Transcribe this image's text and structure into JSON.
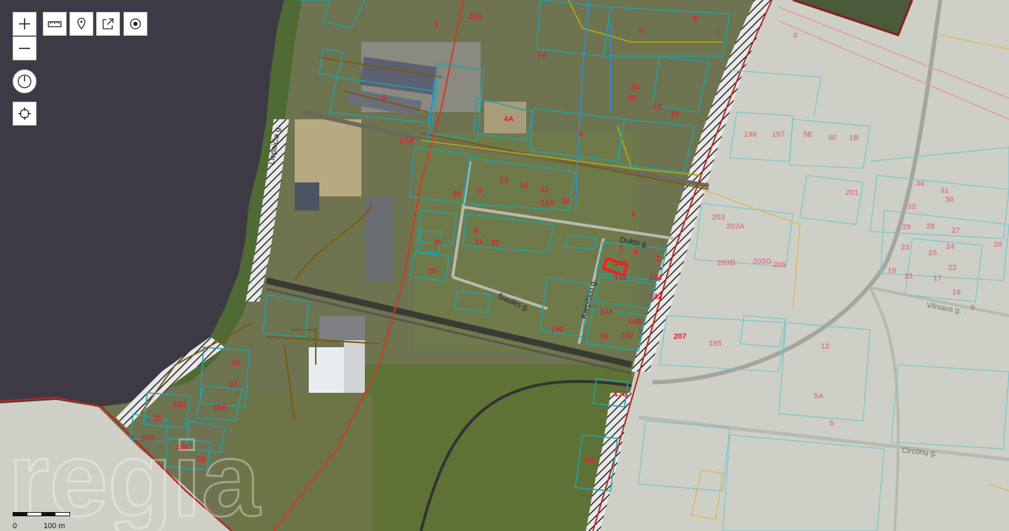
{
  "controls": {
    "zoom_in_icon": "plus-icon",
    "zoom_out_icon": "minus-icon",
    "measure_icon": "ruler-icon",
    "marker_icon": "map-pin-icon",
    "share_icon": "share-icon",
    "layers_icon": "target-icon",
    "compass_icon": "compass-icon",
    "locate_icon": "crosshair-icon"
  },
  "scale": {
    "start": "0",
    "end": "100 m"
  },
  "watermark": "regia",
  "streets": [
    "Dukto g.",
    "Šiaulės g.",
    "Karpiškio g.",
    "Vilniaus g.",
    "Liepaičiø g.",
    "Circūnų g."
  ],
  "parcel_labels": [
    "11A",
    "1",
    "7A",
    "5",
    "6",
    "4",
    "8",
    "4A",
    "3C",
    "3D",
    "16",
    "18",
    "27A",
    "4",
    "20",
    "13",
    "14",
    "12",
    "12A",
    "10",
    "6",
    "5",
    "9",
    "11",
    "21",
    "16",
    "20",
    "7",
    "5",
    "1",
    "138",
    "132",
    "134",
    "142",
    "148",
    "150",
    "14B",
    "14",
    "152",
    "13B",
    "29",
    "31",
    "33",
    "35A",
    "35D",
    "35",
    "35B",
    "35C",
    "36",
    "34",
    "31",
    "32",
    "30",
    "29",
    "28",
    "27",
    "20",
    "23",
    "24",
    "25",
    "22",
    "21",
    "17",
    "18",
    "19",
    "9",
    "12",
    "5A",
    "5",
    "201",
    "203",
    "203A",
    "203B",
    "203G",
    "205",
    "207",
    "195",
    "197",
    "198",
    "5E",
    "5F",
    "1B",
    "3"
  ],
  "colors": {
    "parcel_outline": "#1fa3a8",
    "label": "#e0202c",
    "boundary": "#c0392b",
    "utility": "#8a6a12",
    "water": "#3d3a45",
    "selected": "#ff1a1a"
  }
}
